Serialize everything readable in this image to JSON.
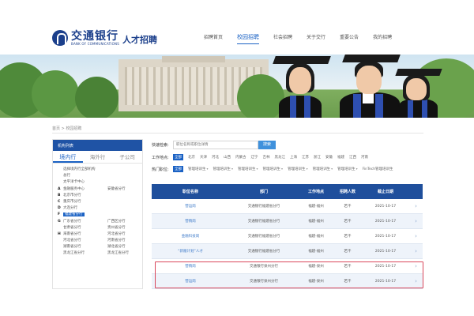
{
  "brand": {
    "name_cn": "交通银行",
    "name_en": "BANK OF COMMUNICATIONS",
    "subtitle": "人才招聘",
    "brand_color": "#1b3f8b"
  },
  "nav": {
    "items": [
      {
        "label": "招聘首页",
        "active": false
      },
      {
        "label": "校园招聘",
        "active": true
      },
      {
        "label": "社会招聘",
        "active": false
      },
      {
        "label": "关于交行",
        "active": false
      },
      {
        "label": "重要公告",
        "active": false
      },
      {
        "label": "我的招聘",
        "active": false
      }
    ]
  },
  "breadcrumb": "首页 > 校园招聘",
  "sidebar": {
    "header": "机构列表",
    "tabs": [
      {
        "label": "境内行",
        "active": true
      },
      {
        "label": "海外行",
        "active": false
      },
      {
        "label": "子公司",
        "active": false
      }
    ],
    "rows": [
      {
        "letter": "",
        "c1": "选择境内行全部机构",
        "c2": "",
        "selected": false
      },
      {
        "letter": "",
        "c1": "总行",
        "c2": "",
        "selected": false
      },
      {
        "letter": "",
        "c1": "太平洋卡中心",
        "c2": "",
        "selected": false
      },
      {
        "letter": "A",
        "c1": "金融服务中心",
        "c2": "安徽省分行",
        "selected": false
      },
      {
        "letter": "B",
        "c1": "北京市分行",
        "c2": "",
        "selected": false
      },
      {
        "letter": "C",
        "c1": "重庆市分行",
        "c2": "",
        "selected": false
      },
      {
        "letter": "D",
        "c1": "大连分行",
        "c2": "",
        "selected": false
      },
      {
        "letter": "F",
        "c1": "福建省分行",
        "c2": "",
        "selected": true
      },
      {
        "letter": "G",
        "c1": "广东省分行",
        "c2": "广西区分行",
        "selected": false
      },
      {
        "letter": "",
        "c1": "甘肃省分行",
        "c2": "贵州省分行",
        "selected": false
      },
      {
        "letter": "H",
        "c1": "海南省分行",
        "c2": "河北省分行",
        "selected": false
      },
      {
        "letter": "",
        "c1": "河北省分行",
        "c2": "河南省分行",
        "selected": false
      },
      {
        "letter": "",
        "c1": "湖南省分行",
        "c2": "湖北省分行",
        "selected": false
      },
      {
        "letter": "",
        "c1": "黑龙江省分行",
        "c2": "黑龙江省分行",
        "selected": false
      }
    ]
  },
  "search": {
    "label": "快速检索:",
    "placeholder": "职位名称或职位详情",
    "button": "搜索"
  },
  "filters": {
    "location_label": "工作地点:",
    "locations": [
      {
        "label": "全部",
        "active": true
      },
      {
        "label": "北京",
        "active": false
      },
      {
        "label": "天津",
        "active": false
      },
      {
        "label": "河北",
        "active": false
      },
      {
        "label": "山西",
        "active": false
      },
      {
        "label": "内蒙古",
        "active": false
      },
      {
        "label": "辽宁",
        "active": false
      },
      {
        "label": "吉林",
        "active": false
      },
      {
        "label": "黑龙江",
        "active": false
      },
      {
        "label": "上海",
        "active": false
      },
      {
        "label": "江苏",
        "active": false
      },
      {
        "label": "浙江",
        "active": false
      },
      {
        "label": "安徽",
        "active": false
      },
      {
        "label": "福建",
        "active": false
      },
      {
        "label": "江西",
        "active": false
      },
      {
        "label": "河南",
        "active": false
      }
    ],
    "hot_label": "热门职位:",
    "hot": [
      {
        "label": "全部",
        "active": true
      },
      {
        "label": "管理培训生",
        "active": false
      },
      {
        "label": "管理培训生",
        "active": false
      },
      {
        "label": "管理培训生",
        "active": false
      },
      {
        "label": "管理培训生",
        "active": false
      },
      {
        "label": "管理培训生",
        "active": false
      },
      {
        "label": "管理培训生",
        "active": false
      },
      {
        "label": "管理培训生",
        "active": false
      },
      {
        "label": "FinTech管理培训生",
        "active": false
      }
    ]
  },
  "table": {
    "headers": [
      "职位名称",
      "部门",
      "工作地点",
      "招聘人数",
      "截止日期"
    ],
    "rows": [
      {
        "name": "营运岗",
        "dept": "交通银行福建省分行",
        "loc": "福建-福州",
        "num": "若干",
        "date": "2021-10-17"
      },
      {
        "name": "营销岗",
        "dept": "交通银行福建省分行",
        "loc": "福建-福州",
        "num": "若干",
        "date": "2021-10-17"
      },
      {
        "name": "金融科技岗",
        "dept": "交通银行福建省分行",
        "loc": "福建-福州",
        "num": "若干",
        "date": "2021-10-17"
      },
      {
        "name": "“新雁计划”人才",
        "dept": "交通银行福建省分行",
        "loc": "福建-福州",
        "num": "若干",
        "date": "2021-10-17"
      },
      {
        "name": "营销岗",
        "dept": "交通银行泉州分行",
        "loc": "福建-泉州",
        "num": "若干",
        "date": "2021-10-17"
      },
      {
        "name": "营运岗",
        "dept": "交通银行泉州分行",
        "loc": "福建-泉州",
        "num": "若干",
        "date": "2021-10-17"
      }
    ],
    "arrow": "›"
  },
  "colors": {
    "primary": "#1f53a5",
    "table_header": "#1f4f9c",
    "search_button": "#3f91dc",
    "highlight": "#d9485b"
  }
}
